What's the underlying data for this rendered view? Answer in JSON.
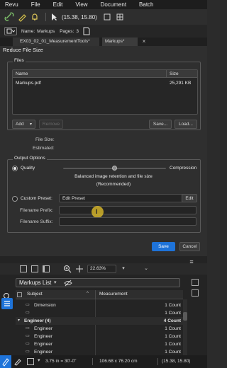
{
  "menu": [
    "Revu",
    "File",
    "Edit",
    "View",
    "Document",
    "Batch"
  ],
  "toolbar": {
    "coords": "(15.38, 15.80)"
  },
  "docbar": {
    "name_label": "Name:",
    "name_value": "Markups",
    "pages_label": "Pages:",
    "pages_value": "3"
  },
  "tabs": [
    "EX03_02_01_MeasurementTools*",
    "Markups*"
  ],
  "dialog": {
    "title": "Reduce File Size",
    "files_group": "Files",
    "col_name": "Name",
    "col_size": "Size",
    "file_name": "Markups.pdf",
    "file_size": "25,291 KB",
    "add_button": "Add",
    "remove_button": "Remove",
    "save_button": "Save...",
    "load_button": "Load...",
    "file_size_label": "File Size:",
    "estimated_label": "Estimated:",
    "output_group": "Output Options",
    "quality_label": "Quality",
    "compression_label": "Compression",
    "slider_level": 0.5,
    "balanced_line1": "Balanced image retention and file size",
    "balanced_line2": "(Recommended)",
    "custom_preset_label": "Custom Preset:",
    "preset_value": "Edit Preset",
    "edit_button": "Edit",
    "prefix_label": "Filename Prefix:",
    "suffix_label": "Filename Suffix:",
    "save_primary": "Save",
    "cancel_button": "Cancel"
  },
  "panel_toolbar": {
    "zoom": "22.63%"
  },
  "markups": {
    "title": "Markups List",
    "col_subject": "Subject",
    "col_measurement": "Measurement",
    "rows": [
      {
        "subject": "Dimension",
        "measurement": "1 Count",
        "level": 2
      },
      {
        "subject": "",
        "measurement": "1 Count",
        "level": 2
      },
      {
        "subject": "Engineer (4)",
        "measurement": "4 Count",
        "level": 1
      },
      {
        "subject": "Engineer",
        "measurement": "1 Count",
        "level": 2
      },
      {
        "subject": "Engineer",
        "measurement": "1 Count",
        "level": 2
      },
      {
        "subject": "Engineer",
        "measurement": "1 Count",
        "level": 2
      },
      {
        "subject": "Engineer",
        "measurement": "1 Count",
        "level": 2
      }
    ]
  },
  "status": {
    "scale": "3.75 in = 30'-0\"",
    "dims": "106.68 x 76.20 cm",
    "coords": "(15.38, 15.80)"
  },
  "colors": {
    "accent": "#1e73d9",
    "highlight": "#e8c42a",
    "background": "#2f2f2f"
  }
}
